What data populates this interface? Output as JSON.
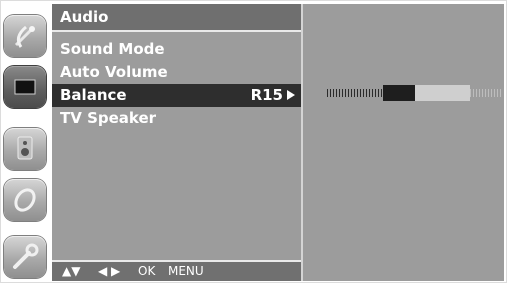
{
  "menu": {
    "title": "Audio",
    "items": [
      {
        "label": "Sound Mode"
      },
      {
        "label": "Auto Volume"
      },
      {
        "label": "Balance",
        "value": "R15",
        "selected": true
      },
      {
        "label": "TV Speaker"
      }
    ],
    "footer": {
      "updown": "▲▼",
      "leftright": "◀ ▶",
      "ok": "OK",
      "menu": "MENU"
    }
  },
  "rail": {
    "icons": [
      "satellite-dish-icon",
      "tv-screen-icon",
      "speaker-icon",
      "clock-icon",
      "wrench-icon"
    ],
    "active_index": 1
  },
  "balance_bar": {
    "value": 15,
    "min": -50,
    "max": 50,
    "colors": {
      "dark": "#1e1e1e",
      "light": "#cfcfcf",
      "tick": "#2a2a2a",
      "tick_light": "#bdbdbd"
    }
  },
  "colors": {
    "panel": "#9c9c9c",
    "title_bar": "#6f6f6f",
    "selected_row": "#2e2e2e",
    "text": "#ffffff"
  }
}
